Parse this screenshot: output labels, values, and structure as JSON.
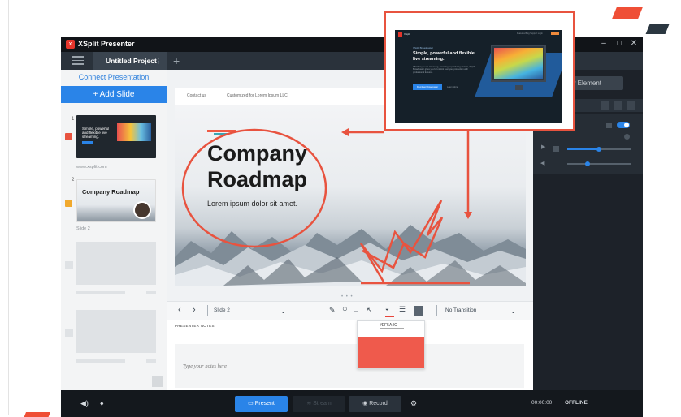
{
  "window": {
    "app_title": "XSplit Presenter",
    "controls": [
      "–",
      "□",
      "✕"
    ]
  },
  "tabs": {
    "project": "Untitled Project",
    "more": "⋮",
    "add": "+"
  },
  "sidebar": {
    "connect_link": "Connect Presentation",
    "add_slide": "+ Add Slide",
    "slides": [
      {
        "number": "1",
        "caption": "www.xsplit.com",
        "thumb_text": "Simple, powerful and flexible live streaming."
      },
      {
        "number": "2",
        "caption": "Slide 2",
        "thumb_title": "Company Roadmap"
      }
    ]
  },
  "slide": {
    "header_a": "Contact us",
    "header_b": "Customized for Lorem Ipsum LLC",
    "title": "Company Roadmap",
    "subtitle": "Lorem ipsum dolor sit amet.",
    "divider": "• • •"
  },
  "toolbar": {
    "prev": "‹",
    "next": "›",
    "slide_name": "Slide 2",
    "transition": "No Transition",
    "icons": [
      "pen-icon",
      "circle-icon",
      "rectangle-icon",
      "pointer-icon",
      "fill-color-icon",
      "line-weight-icon",
      "notes-toggle-icon"
    ]
  },
  "notes": {
    "label": "PRESENTER NOTES",
    "placeholder": "Type your notes here"
  },
  "color_picker": {
    "hex": "#EF5A4C",
    "swatch_color": "#EF5A4C"
  },
  "right_panel": {
    "overlay_button": "+ Overlay Element"
  },
  "bottombar": {
    "present": "Present",
    "stream": "Stream",
    "record": "Record",
    "time": "00:00:00",
    "status": "OFFLINE"
  },
  "callout": {
    "brand": "XSplit",
    "nav": "Features   Blog   Support   Login",
    "tag": "XSplit Broadcaster",
    "headline": "Simple, powerful and flexible live streaming.",
    "body": "Whether you are streaming, recording or producing content, XSplit Broadcaster gives you full control over your production with professional features.",
    "cta": "Download Broadcaster",
    "cta2": "Learn More"
  },
  "colors": {
    "accent": "#2A84E8",
    "annotation": "#E8533F",
    "app_bg": "#1D2229"
  }
}
